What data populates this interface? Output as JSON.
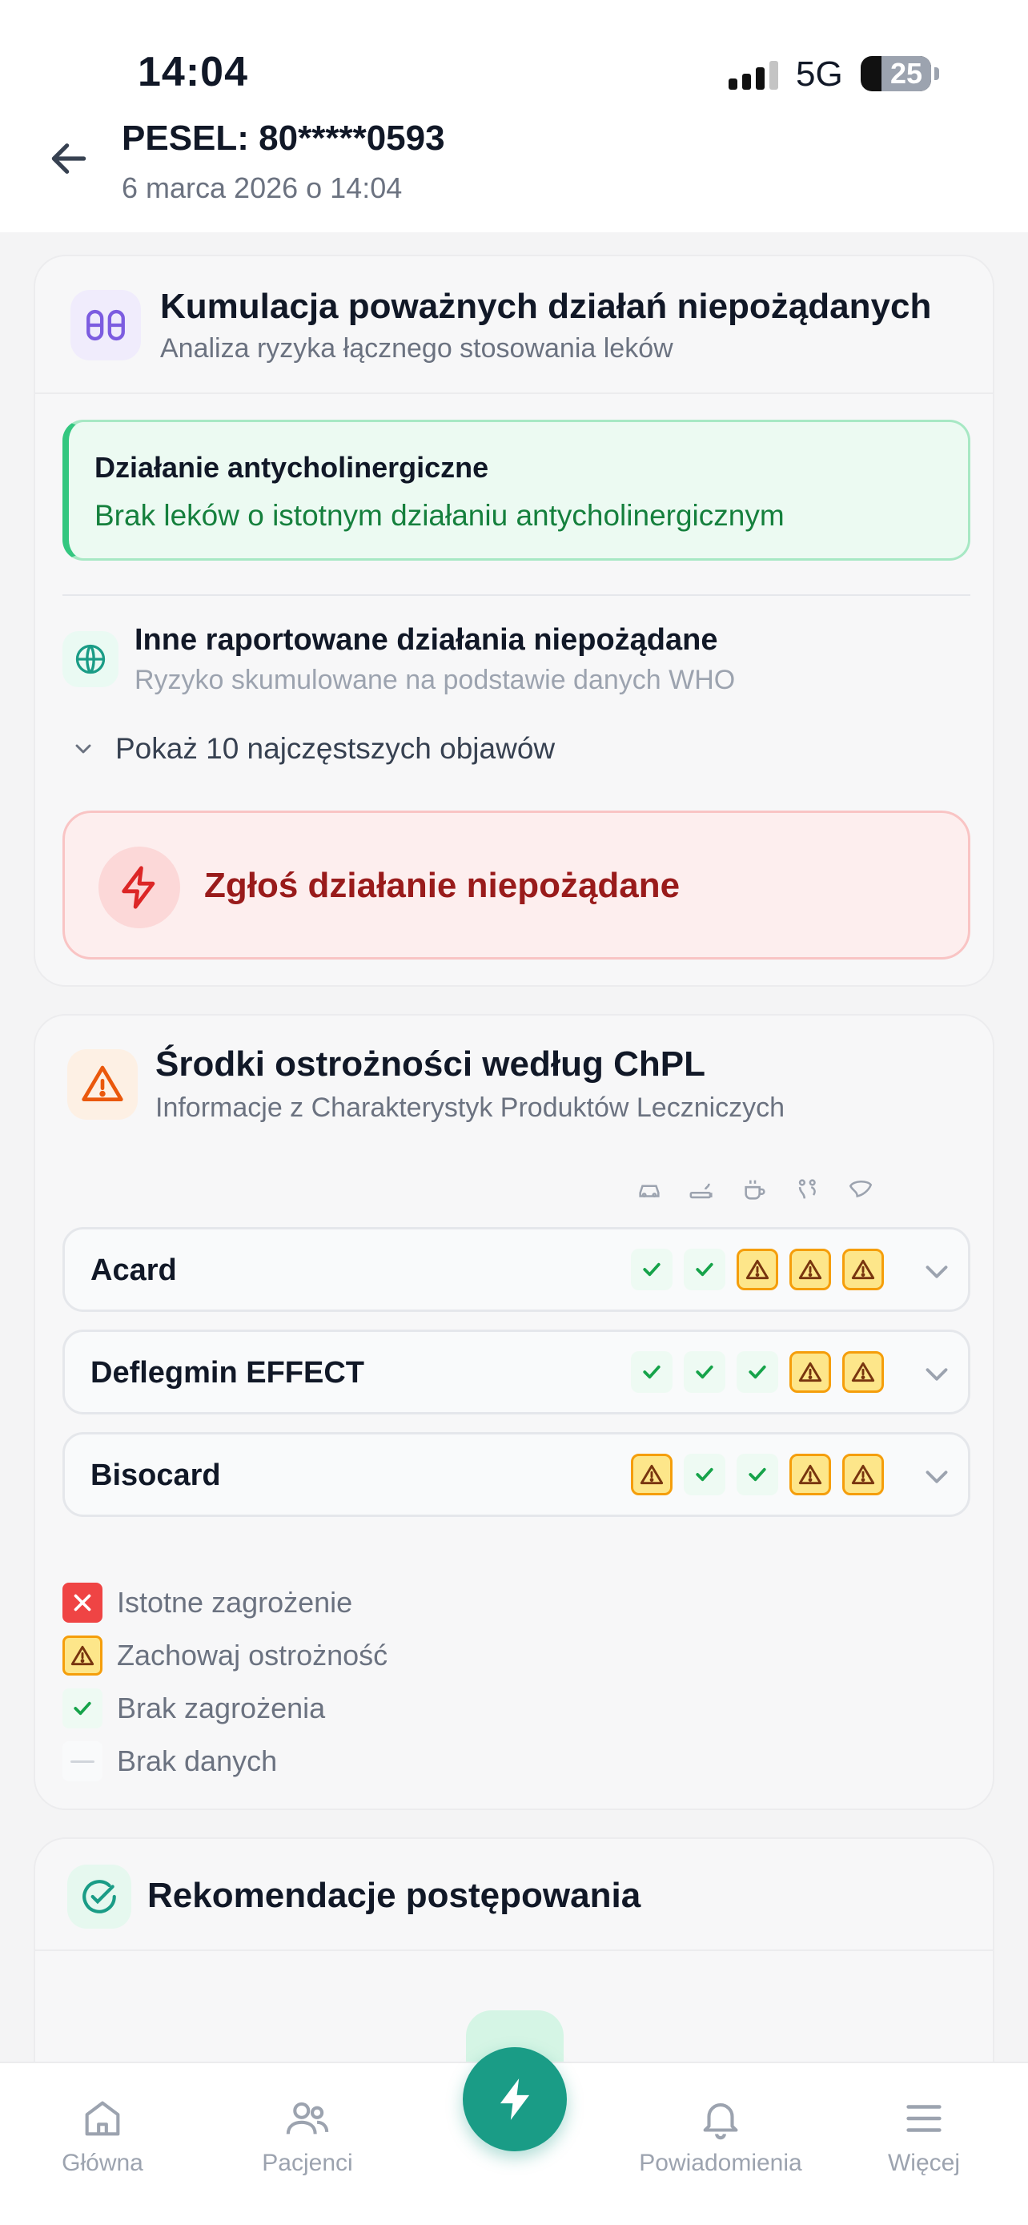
{
  "status_bar": {
    "time": "14:04",
    "network": "5G",
    "battery": "25"
  },
  "header": {
    "title": "PESEL: 80*****0593",
    "subtitle": "6 marca 2026 o 14:04"
  },
  "cumulation": {
    "title": "Kumulacja poważnych działań niepożądanych",
    "subtitle": "Analiza ryzyka łącznego stosowania leków",
    "anticholinergic": {
      "title": "Działanie antycholinergiczne",
      "status": "Brak leków o istotnym działaniu antycholinergicznym"
    },
    "who": {
      "title": "Inne raportowane działania niepożądane",
      "subtitle": "Ryzyko skumulowane na podstawie danych WHO",
      "toggle_label": "Pokaż 10 najczęstszych objawów"
    },
    "report_button": "Zgłoś działanie niepożądane"
  },
  "precautions": {
    "title": "Środki ostrożności według ChPL",
    "subtitle": "Informacje z Charakterystyk Produktów Leczniczych",
    "columns": [
      "car-icon",
      "smoking-icon",
      "coffee-icon",
      "pregnancy-icon",
      "liver-icon"
    ],
    "drugs": [
      {
        "name": "Acard",
        "values": [
          "ok",
          "ok",
          "warn",
          "warn",
          "warn"
        ]
      },
      {
        "name": "Deflegmin EFFECT",
        "values": [
          "ok",
          "ok",
          "ok",
          "warn",
          "warn"
        ]
      },
      {
        "name": "Bisocard",
        "values": [
          "warn",
          "ok",
          "ok",
          "warn",
          "warn"
        ]
      }
    ],
    "legend": [
      {
        "type": "danger",
        "label": "Istotne zagrożenie"
      },
      {
        "type": "warn",
        "label": "Zachowaj ostrożność"
      },
      {
        "type": "ok",
        "label": "Brak zagrożenia"
      },
      {
        "type": "none",
        "label": "Brak danych"
      }
    ]
  },
  "recommendations": {
    "title": "Rekomendacje postępowania"
  },
  "nav": [
    {
      "label": "Główna",
      "icon": "home-icon"
    },
    {
      "label": "Pacjenci",
      "icon": "users-icon"
    },
    {
      "label": "Powiadomienia",
      "icon": "bell-icon"
    },
    {
      "label": "Więcej",
      "icon": "menu-icon"
    }
  ],
  "colors": {
    "accent": "#1a9c86",
    "danger": "#991b1b",
    "success": "#15803d",
    "warn": "#f59e0b"
  }
}
